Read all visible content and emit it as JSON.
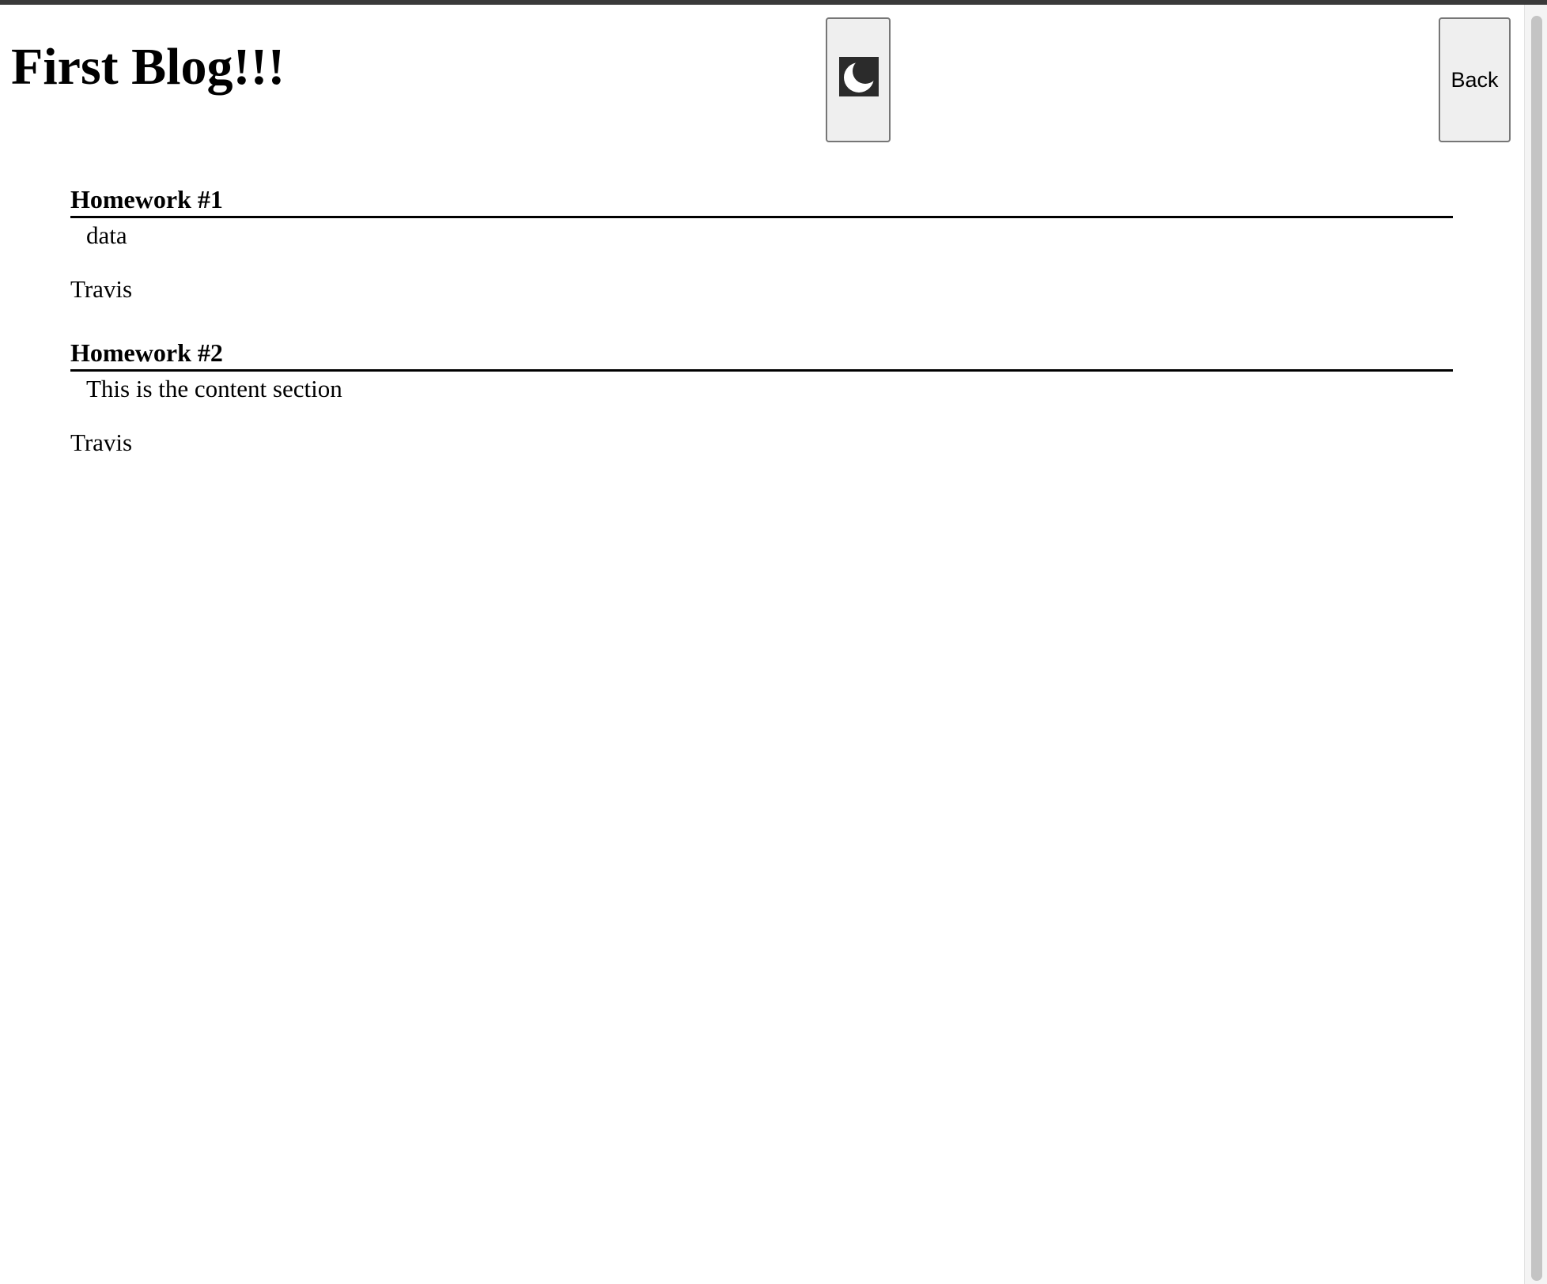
{
  "page": {
    "title": "First Blog!!!"
  },
  "header": {
    "theme_toggle_icon": "moon-icon",
    "back_label": "Back"
  },
  "posts": [
    {
      "title": "Homework #1",
      "content": "data",
      "author": "Travis"
    },
    {
      "title": "Homework #2",
      "content": "This is the content section",
      "author": "Travis"
    }
  ],
  "colors": {
    "background": "#ffffff",
    "text": "#000000",
    "button_bg": "#efefef",
    "button_border": "#767676",
    "icon_bg": "#2b2b2b"
  }
}
